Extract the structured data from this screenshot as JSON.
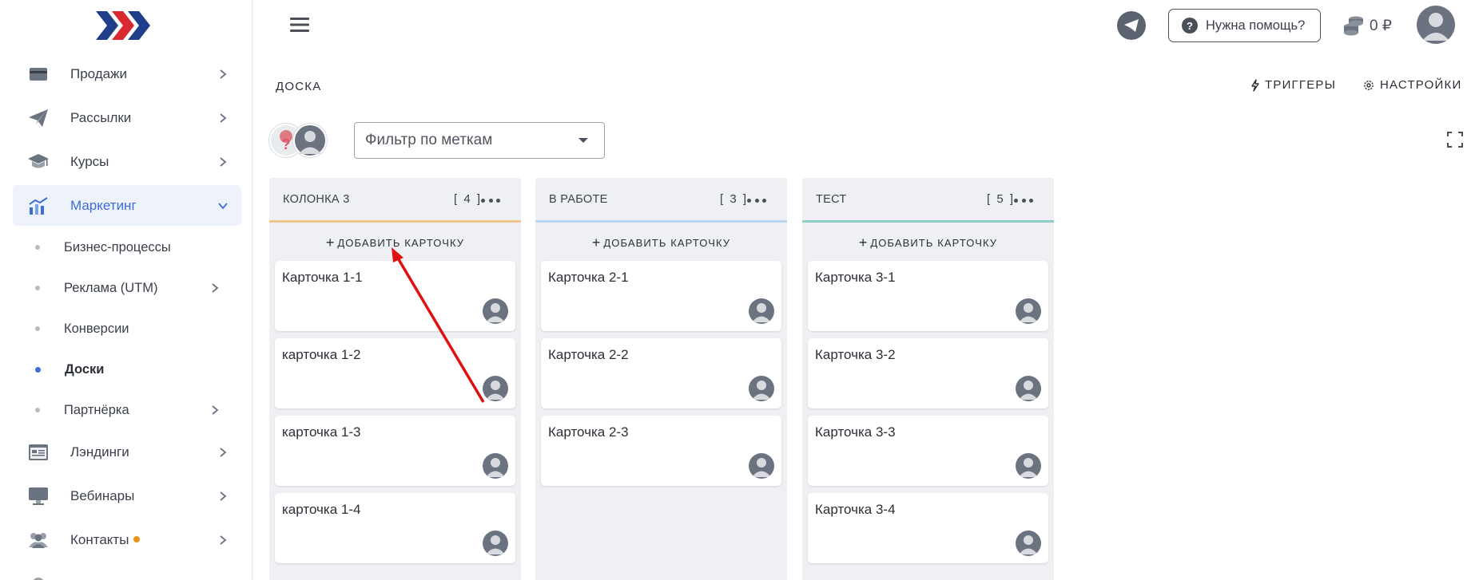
{
  "sidebar": {
    "nav": [
      {
        "label": "Продажи",
        "icon": "wallet-icon"
      },
      {
        "label": "Рассылки",
        "icon": "paper-plane-icon"
      },
      {
        "label": "Курсы",
        "icon": "graduation-cap-icon"
      },
      {
        "label": "Маркетинг",
        "icon": "chart-up-icon",
        "active": true
      }
    ],
    "sub": [
      {
        "label": "Бизнес-процессы"
      },
      {
        "label": "Реклама (UTM)"
      },
      {
        "label": "Конверсии"
      },
      {
        "label": "Доски",
        "active": true
      },
      {
        "label": "Партнёрка"
      }
    ],
    "nav2": [
      {
        "label": "Лэндинги",
        "icon": "landing-page-icon"
      },
      {
        "label": "Вебинары",
        "icon": "monitor-icon"
      },
      {
        "label": "Контакты",
        "icon": "users-icon"
      }
    ]
  },
  "header": {
    "help_label": "Нужна помощь?",
    "balance": "0 ₽"
  },
  "board": {
    "title": "ДОСКА",
    "triggers_label": "ТРИГГЕРЫ",
    "settings_label": "НАСТРОЙКИ",
    "filter_placeholder": "Фильтр по меткам",
    "add_card_label": "ДОБАВИТЬ КАРТОЧКУ",
    "columns": [
      {
        "name": "КОЛОНКА 3",
        "count": "[ 4 ]",
        "color": "#f3c58a",
        "cards": [
          "Карточка 1-1",
          "карточка 1-2",
          "карточка 1-3",
          "карточка 1-4"
        ]
      },
      {
        "name": "В РАБОТЕ",
        "count": "[ 3 ]",
        "color": "#b9d6f2",
        "cards": [
          "Карточка 2-1",
          "Карточка 2-2",
          "Карточка 2-3"
        ]
      },
      {
        "name": "ТЕСТ",
        "count": "[ 5 ]",
        "color": "#8fcfc6",
        "cards": [
          "Карточка 3-1",
          "Карточка 3-2",
          "Карточка 3-3",
          "Карточка 3-4"
        ]
      }
    ]
  },
  "colors": {
    "accent": "#3d6dd8",
    "annotation_arrow": "#e01010"
  }
}
